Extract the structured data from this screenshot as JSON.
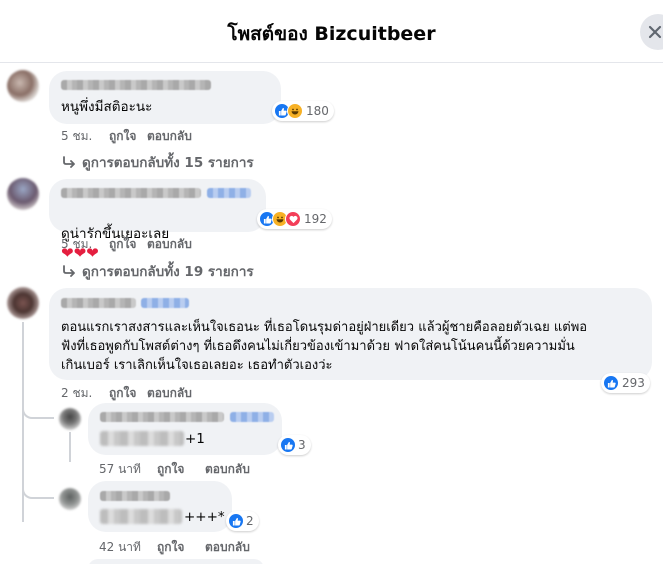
{
  "header": {
    "title": "โพสต์ของ Bizcuitbeer"
  },
  "comments": [
    {
      "text": "หนูพึ่งมีสติอะนะ",
      "reactions": [
        "like",
        "haha"
      ],
      "reaction_count": "180",
      "time": "5 ชม.",
      "like_label": "ถูกใจ",
      "reply_label": "ตอบกลับ",
      "view_replies": "ดูการตอบกลับทั้ง 15 รายการ"
    },
    {
      "text": "ดูน่ารักขึ้นเยอะเลย ❤️❤️❤️",
      "text_main": "ดูน่ารักขึ้นเยอะเลย",
      "hearts": "❤❤❤",
      "reactions": [
        "like",
        "haha",
        "love"
      ],
      "reaction_count": "192",
      "time": "5 ชม.",
      "like_label": "ถูกใจ",
      "reply_label": "ตอบกลับ",
      "view_replies": "ดูการตอบกลับทั้ง 19 รายการ"
    },
    {
      "text": "ตอนแรกเราสงสารและเห็นใจเธอนะ ที่เธอโดนรุมด่าอยู่ฝ่ายเดียว แล้วผู้ชายคือลอยตัวเฉย แต่พอ\nฟังที่เธอพูดกับโพสต์ต่างๆ ที่เธอดึงคนไม่เกี่ยวข้องเข้ามาด้วย ฟาดใส่คนโน้นคนนี้ด้วยความมั่น\nเกินเบอร์ เราเลิกเห็นใจเธอเลยอะ เธอทำตัวเองว่ะ",
      "reactions": [
        "like"
      ],
      "reaction_count": "293",
      "time": "2 ชม.",
      "like_label": "ถูกใจ",
      "reply_label": "ตอบกลับ"
    }
  ],
  "replies": [
    {
      "text_suffix": "+1",
      "reactions": [
        "like"
      ],
      "reaction_count": "3",
      "time": "57 นาที",
      "like_label": "ถูกใจ",
      "reply_label": "ตอบกลับ"
    },
    {
      "text_suffix": "+++*",
      "reactions": [
        "like"
      ],
      "reaction_count": "2",
      "time": "42 นาที",
      "like_label": "ถูกใจ",
      "reply_label": "ตอบกลับ"
    }
  ],
  "colors": {
    "like": "#1877f2",
    "haha": "#f7b125",
    "love": "#f33e58",
    "heart": "#e41e3f",
    "bubble": "#f0f2f5",
    "meta": "#65676b"
  }
}
